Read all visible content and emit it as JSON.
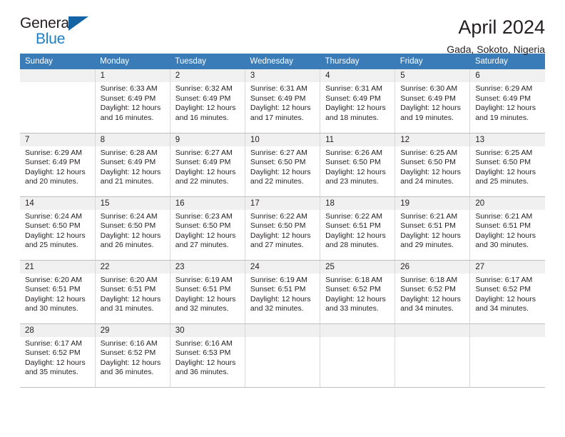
{
  "brand": {
    "name_top": "General",
    "name_bottom": "Blue",
    "logo_color": "#1464a5",
    "text_color": "#1c7fc4"
  },
  "header": {
    "title": "April 2024",
    "subtitle": "Gada, Sokoto, Nigeria"
  },
  "calendar": {
    "accent_color": "#3a7cb8",
    "daynum_bg": "#f0f0f0",
    "weekday_headers": [
      "Sunday",
      "Monday",
      "Tuesday",
      "Wednesday",
      "Thursday",
      "Friday",
      "Saturday"
    ],
    "labels": {
      "sunrise": "Sunrise:",
      "sunset": "Sunset:",
      "daylight": "Daylight:"
    },
    "weeks": [
      [
        {
          "day": "",
          "empty": true
        },
        {
          "day": "1",
          "sunrise": "Sunrise: 6:33 AM",
          "sunset": "Sunset: 6:49 PM",
          "daylight_1": "Daylight: 12 hours",
          "daylight_2": "and 16 minutes."
        },
        {
          "day": "2",
          "sunrise": "Sunrise: 6:32 AM",
          "sunset": "Sunset: 6:49 PM",
          "daylight_1": "Daylight: 12 hours",
          "daylight_2": "and 16 minutes."
        },
        {
          "day": "3",
          "sunrise": "Sunrise: 6:31 AM",
          "sunset": "Sunset: 6:49 PM",
          "daylight_1": "Daylight: 12 hours",
          "daylight_2": "and 17 minutes."
        },
        {
          "day": "4",
          "sunrise": "Sunrise: 6:31 AM",
          "sunset": "Sunset: 6:49 PM",
          "daylight_1": "Daylight: 12 hours",
          "daylight_2": "and 18 minutes."
        },
        {
          "day": "5",
          "sunrise": "Sunrise: 6:30 AM",
          "sunset": "Sunset: 6:49 PM",
          "daylight_1": "Daylight: 12 hours",
          "daylight_2": "and 19 minutes."
        },
        {
          "day": "6",
          "sunrise": "Sunrise: 6:29 AM",
          "sunset": "Sunset: 6:49 PM",
          "daylight_1": "Daylight: 12 hours",
          "daylight_2": "and 19 minutes."
        }
      ],
      [
        {
          "day": "7",
          "sunrise": "Sunrise: 6:29 AM",
          "sunset": "Sunset: 6:49 PM",
          "daylight_1": "Daylight: 12 hours",
          "daylight_2": "and 20 minutes."
        },
        {
          "day": "8",
          "sunrise": "Sunrise: 6:28 AM",
          "sunset": "Sunset: 6:49 PM",
          "daylight_1": "Daylight: 12 hours",
          "daylight_2": "and 21 minutes."
        },
        {
          "day": "9",
          "sunrise": "Sunrise: 6:27 AM",
          "sunset": "Sunset: 6:49 PM",
          "daylight_1": "Daylight: 12 hours",
          "daylight_2": "and 22 minutes."
        },
        {
          "day": "10",
          "sunrise": "Sunrise: 6:27 AM",
          "sunset": "Sunset: 6:50 PM",
          "daylight_1": "Daylight: 12 hours",
          "daylight_2": "and 22 minutes."
        },
        {
          "day": "11",
          "sunrise": "Sunrise: 6:26 AM",
          "sunset": "Sunset: 6:50 PM",
          "daylight_1": "Daylight: 12 hours",
          "daylight_2": "and 23 minutes."
        },
        {
          "day": "12",
          "sunrise": "Sunrise: 6:25 AM",
          "sunset": "Sunset: 6:50 PM",
          "daylight_1": "Daylight: 12 hours",
          "daylight_2": "and 24 minutes."
        },
        {
          "day": "13",
          "sunrise": "Sunrise: 6:25 AM",
          "sunset": "Sunset: 6:50 PM",
          "daylight_1": "Daylight: 12 hours",
          "daylight_2": "and 25 minutes."
        }
      ],
      [
        {
          "day": "14",
          "sunrise": "Sunrise: 6:24 AM",
          "sunset": "Sunset: 6:50 PM",
          "daylight_1": "Daylight: 12 hours",
          "daylight_2": "and 25 minutes."
        },
        {
          "day": "15",
          "sunrise": "Sunrise: 6:24 AM",
          "sunset": "Sunset: 6:50 PM",
          "daylight_1": "Daylight: 12 hours",
          "daylight_2": "and 26 minutes."
        },
        {
          "day": "16",
          "sunrise": "Sunrise: 6:23 AM",
          "sunset": "Sunset: 6:50 PM",
          "daylight_1": "Daylight: 12 hours",
          "daylight_2": "and 27 minutes."
        },
        {
          "day": "17",
          "sunrise": "Sunrise: 6:22 AM",
          "sunset": "Sunset: 6:50 PM",
          "daylight_1": "Daylight: 12 hours",
          "daylight_2": "and 27 minutes."
        },
        {
          "day": "18",
          "sunrise": "Sunrise: 6:22 AM",
          "sunset": "Sunset: 6:51 PM",
          "daylight_1": "Daylight: 12 hours",
          "daylight_2": "and 28 minutes."
        },
        {
          "day": "19",
          "sunrise": "Sunrise: 6:21 AM",
          "sunset": "Sunset: 6:51 PM",
          "daylight_1": "Daylight: 12 hours",
          "daylight_2": "and 29 minutes."
        },
        {
          "day": "20",
          "sunrise": "Sunrise: 6:21 AM",
          "sunset": "Sunset: 6:51 PM",
          "daylight_1": "Daylight: 12 hours",
          "daylight_2": "and 30 minutes."
        }
      ],
      [
        {
          "day": "21",
          "sunrise": "Sunrise: 6:20 AM",
          "sunset": "Sunset: 6:51 PM",
          "daylight_1": "Daylight: 12 hours",
          "daylight_2": "and 30 minutes."
        },
        {
          "day": "22",
          "sunrise": "Sunrise: 6:20 AM",
          "sunset": "Sunset: 6:51 PM",
          "daylight_1": "Daylight: 12 hours",
          "daylight_2": "and 31 minutes."
        },
        {
          "day": "23",
          "sunrise": "Sunrise: 6:19 AM",
          "sunset": "Sunset: 6:51 PM",
          "daylight_1": "Daylight: 12 hours",
          "daylight_2": "and 32 minutes."
        },
        {
          "day": "24",
          "sunrise": "Sunrise: 6:19 AM",
          "sunset": "Sunset: 6:51 PM",
          "daylight_1": "Daylight: 12 hours",
          "daylight_2": "and 32 minutes."
        },
        {
          "day": "25",
          "sunrise": "Sunrise: 6:18 AM",
          "sunset": "Sunset: 6:52 PM",
          "daylight_1": "Daylight: 12 hours",
          "daylight_2": "and 33 minutes."
        },
        {
          "day": "26",
          "sunrise": "Sunrise: 6:18 AM",
          "sunset": "Sunset: 6:52 PM",
          "daylight_1": "Daylight: 12 hours",
          "daylight_2": "and 34 minutes."
        },
        {
          "day": "27",
          "sunrise": "Sunrise: 6:17 AM",
          "sunset": "Sunset: 6:52 PM",
          "daylight_1": "Daylight: 12 hours",
          "daylight_2": "and 34 minutes."
        }
      ],
      [
        {
          "day": "28",
          "sunrise": "Sunrise: 6:17 AM",
          "sunset": "Sunset: 6:52 PM",
          "daylight_1": "Daylight: 12 hours",
          "daylight_2": "and 35 minutes."
        },
        {
          "day": "29",
          "sunrise": "Sunrise: 6:16 AM",
          "sunset": "Sunset: 6:52 PM",
          "daylight_1": "Daylight: 12 hours",
          "daylight_2": "and 36 minutes."
        },
        {
          "day": "30",
          "sunrise": "Sunrise: 6:16 AM",
          "sunset": "Sunset: 6:53 PM",
          "daylight_1": "Daylight: 12 hours",
          "daylight_2": "and 36 minutes."
        },
        {
          "day": "",
          "empty": true
        },
        {
          "day": "",
          "empty": true
        },
        {
          "day": "",
          "empty": true
        },
        {
          "day": "",
          "empty": true
        }
      ]
    ]
  }
}
